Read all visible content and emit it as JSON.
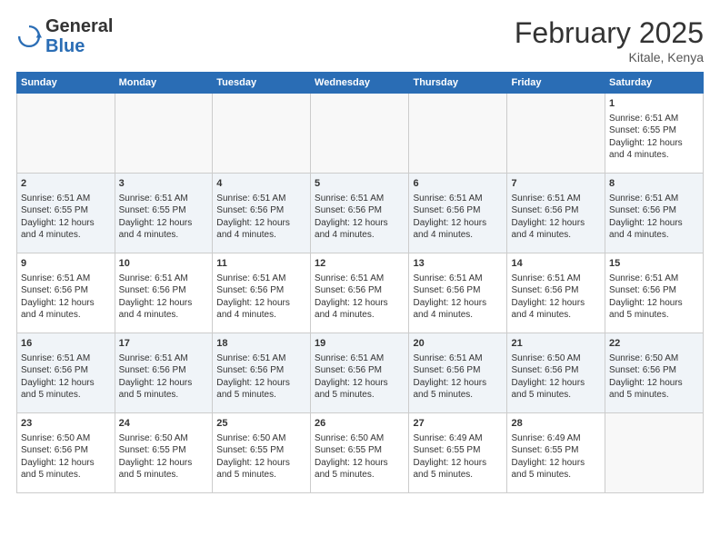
{
  "header": {
    "logo_general": "General",
    "logo_blue": "Blue",
    "month_title": "February 2025",
    "location": "Kitale, Kenya"
  },
  "weekdays": [
    "Sunday",
    "Monday",
    "Tuesday",
    "Wednesday",
    "Thursday",
    "Friday",
    "Saturday"
  ],
  "weeks": [
    [
      {
        "day": "",
        "text": ""
      },
      {
        "day": "",
        "text": ""
      },
      {
        "day": "",
        "text": ""
      },
      {
        "day": "",
        "text": ""
      },
      {
        "day": "",
        "text": ""
      },
      {
        "day": "",
        "text": ""
      },
      {
        "day": "1",
        "text": "Sunrise: 6:51 AM\nSunset: 6:55 PM\nDaylight: 12 hours and 4 minutes."
      }
    ],
    [
      {
        "day": "2",
        "text": "Sunrise: 6:51 AM\nSunset: 6:55 PM\nDaylight: 12 hours and 4 minutes."
      },
      {
        "day": "3",
        "text": "Sunrise: 6:51 AM\nSunset: 6:55 PM\nDaylight: 12 hours and 4 minutes."
      },
      {
        "day": "4",
        "text": "Sunrise: 6:51 AM\nSunset: 6:56 PM\nDaylight: 12 hours and 4 minutes."
      },
      {
        "day": "5",
        "text": "Sunrise: 6:51 AM\nSunset: 6:56 PM\nDaylight: 12 hours and 4 minutes."
      },
      {
        "day": "6",
        "text": "Sunrise: 6:51 AM\nSunset: 6:56 PM\nDaylight: 12 hours and 4 minutes."
      },
      {
        "day": "7",
        "text": "Sunrise: 6:51 AM\nSunset: 6:56 PM\nDaylight: 12 hours and 4 minutes."
      },
      {
        "day": "8",
        "text": "Sunrise: 6:51 AM\nSunset: 6:56 PM\nDaylight: 12 hours and 4 minutes."
      }
    ],
    [
      {
        "day": "9",
        "text": "Sunrise: 6:51 AM\nSunset: 6:56 PM\nDaylight: 12 hours and 4 minutes."
      },
      {
        "day": "10",
        "text": "Sunrise: 6:51 AM\nSunset: 6:56 PM\nDaylight: 12 hours and 4 minutes."
      },
      {
        "day": "11",
        "text": "Sunrise: 6:51 AM\nSunset: 6:56 PM\nDaylight: 12 hours and 4 minutes."
      },
      {
        "day": "12",
        "text": "Sunrise: 6:51 AM\nSunset: 6:56 PM\nDaylight: 12 hours and 4 minutes."
      },
      {
        "day": "13",
        "text": "Sunrise: 6:51 AM\nSunset: 6:56 PM\nDaylight: 12 hours and 4 minutes."
      },
      {
        "day": "14",
        "text": "Sunrise: 6:51 AM\nSunset: 6:56 PM\nDaylight: 12 hours and 4 minutes."
      },
      {
        "day": "15",
        "text": "Sunrise: 6:51 AM\nSunset: 6:56 PM\nDaylight: 12 hours and 5 minutes."
      }
    ],
    [
      {
        "day": "16",
        "text": "Sunrise: 6:51 AM\nSunset: 6:56 PM\nDaylight: 12 hours and 5 minutes."
      },
      {
        "day": "17",
        "text": "Sunrise: 6:51 AM\nSunset: 6:56 PM\nDaylight: 12 hours and 5 minutes."
      },
      {
        "day": "18",
        "text": "Sunrise: 6:51 AM\nSunset: 6:56 PM\nDaylight: 12 hours and 5 minutes."
      },
      {
        "day": "19",
        "text": "Sunrise: 6:51 AM\nSunset: 6:56 PM\nDaylight: 12 hours and 5 minutes."
      },
      {
        "day": "20",
        "text": "Sunrise: 6:51 AM\nSunset: 6:56 PM\nDaylight: 12 hours and 5 minutes."
      },
      {
        "day": "21",
        "text": "Sunrise: 6:50 AM\nSunset: 6:56 PM\nDaylight: 12 hours and 5 minutes."
      },
      {
        "day": "22",
        "text": "Sunrise: 6:50 AM\nSunset: 6:56 PM\nDaylight: 12 hours and 5 minutes."
      }
    ],
    [
      {
        "day": "23",
        "text": "Sunrise: 6:50 AM\nSunset: 6:56 PM\nDaylight: 12 hours and 5 minutes."
      },
      {
        "day": "24",
        "text": "Sunrise: 6:50 AM\nSunset: 6:55 PM\nDaylight: 12 hours and 5 minutes."
      },
      {
        "day": "25",
        "text": "Sunrise: 6:50 AM\nSunset: 6:55 PM\nDaylight: 12 hours and 5 minutes."
      },
      {
        "day": "26",
        "text": "Sunrise: 6:50 AM\nSunset: 6:55 PM\nDaylight: 12 hours and 5 minutes."
      },
      {
        "day": "27",
        "text": "Sunrise: 6:49 AM\nSunset: 6:55 PM\nDaylight: 12 hours and 5 minutes."
      },
      {
        "day": "28",
        "text": "Sunrise: 6:49 AM\nSunset: 6:55 PM\nDaylight: 12 hours and 5 minutes."
      },
      {
        "day": "",
        "text": ""
      }
    ]
  ]
}
